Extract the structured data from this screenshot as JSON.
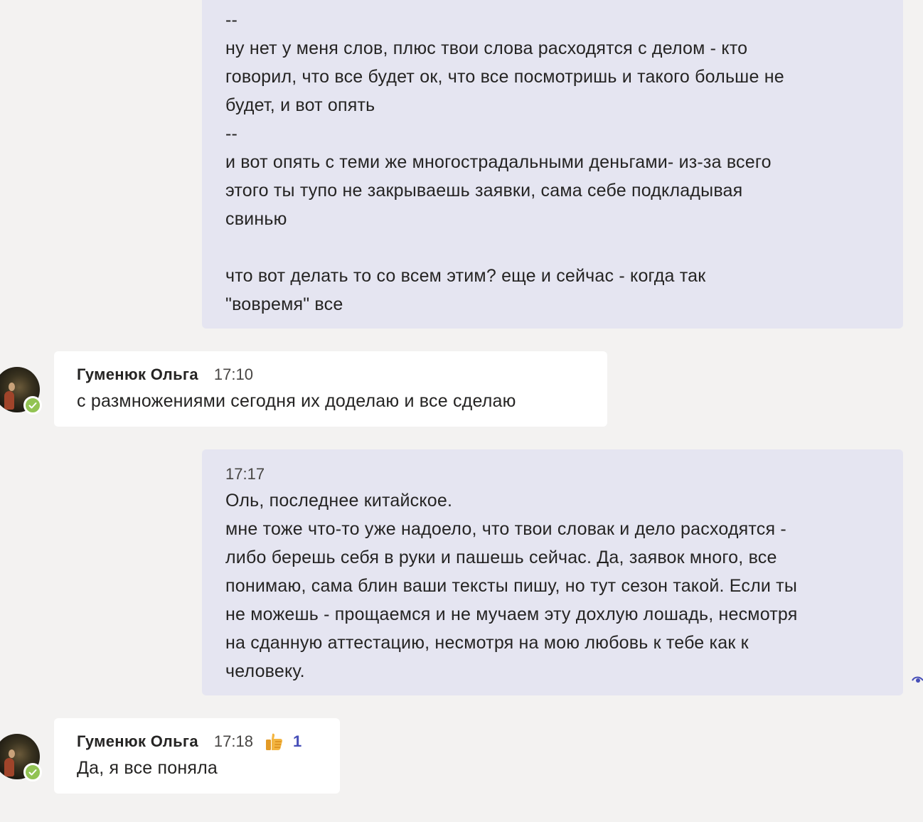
{
  "messages": [
    {
      "direction": "outgoing",
      "lines": [
        "--",
        "ну нет у меня слов, плюс твои слова расходятся с делом - кто",
        "говорил, что все будет ок, что все посмотришь и такого больше не",
        "будет, и вот опять",
        "--",
        "и вот опять с теми же многострадальными деньгами- из-за всего",
        "этого ты тупо не закрываешь заявки, сама себе подкладывая",
        "свинью",
        "",
        "что вот делать то со всем этим? еще и сейчас - когда так",
        "\"вовремя\" все"
      ]
    },
    {
      "direction": "incoming",
      "sender": "Гуменюк Ольга",
      "time": "17:10",
      "text": "с размножениями сегодня их доделаю и все сделаю",
      "avatar_icon": "avatar-photo",
      "status": "available"
    },
    {
      "direction": "outgoing",
      "time": "17:17",
      "lines": [
        "Оль, последнее китайское.",
        "мне тоже что-то уже надоело, что твои словак и дело расходятся -",
        "либо берешь себя в руки и пашешь сейчас. Да, заявок много, все",
        "понимаю, сама блин ваши тексты пишу, но тут сезон такой. Если ты",
        "не можешь - прощаемся и не мучаем эту дохлую лошадь, несмотря",
        "на сданную аттестацию, несмотря на мою любовь к тебе как к",
        "человеку."
      ]
    },
    {
      "direction": "incoming",
      "sender": "Гуменюк Ольга",
      "time": "17:18",
      "text": "Да, я все поняла",
      "avatar_icon": "avatar-photo",
      "status": "available",
      "reaction": {
        "icon": "thumbs-up-icon",
        "count": "1"
      }
    }
  ],
  "colors": {
    "background": "#f3f2f1",
    "outgoing_bubble": "#e5e5f1",
    "incoming_bubble": "#ffffff",
    "accent": "#464eb8",
    "status_available": "#92c353"
  }
}
